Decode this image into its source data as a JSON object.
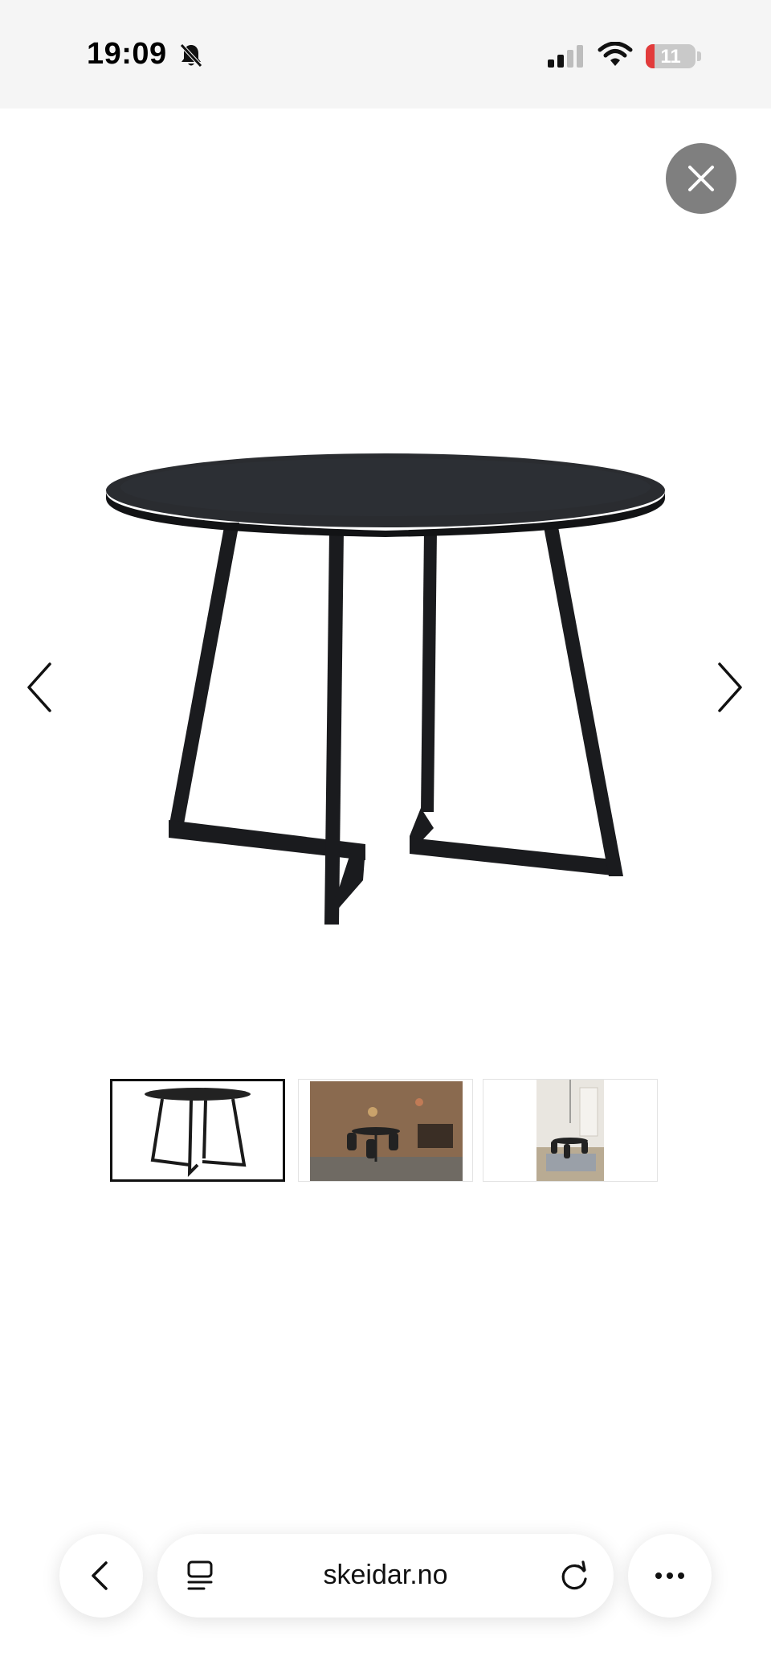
{
  "status_bar": {
    "time": "19:09",
    "battery_level": "11",
    "battery_fraction": 0.11,
    "icons": [
      "bell-slash-icon",
      "cellular-signal-icon",
      "wifi-icon",
      "battery-icon"
    ]
  },
  "viewer": {
    "icons": [
      "close-icon",
      "chevron-left-icon",
      "chevron-right-icon"
    ],
    "selected_index": 0,
    "thumbnails": [
      "table-product",
      "dining-room-dark",
      "dining-room-light"
    ]
  },
  "browser": {
    "url": "skeidar.no",
    "icons": [
      "back-icon",
      "reader-icon",
      "reload-icon",
      "more-icon"
    ]
  },
  "colors": {
    "status_bg": "#f5f5f5",
    "close_bg": "#7f7f7f",
    "battery_low": "#e23b3b",
    "table": "#1d1f22"
  }
}
